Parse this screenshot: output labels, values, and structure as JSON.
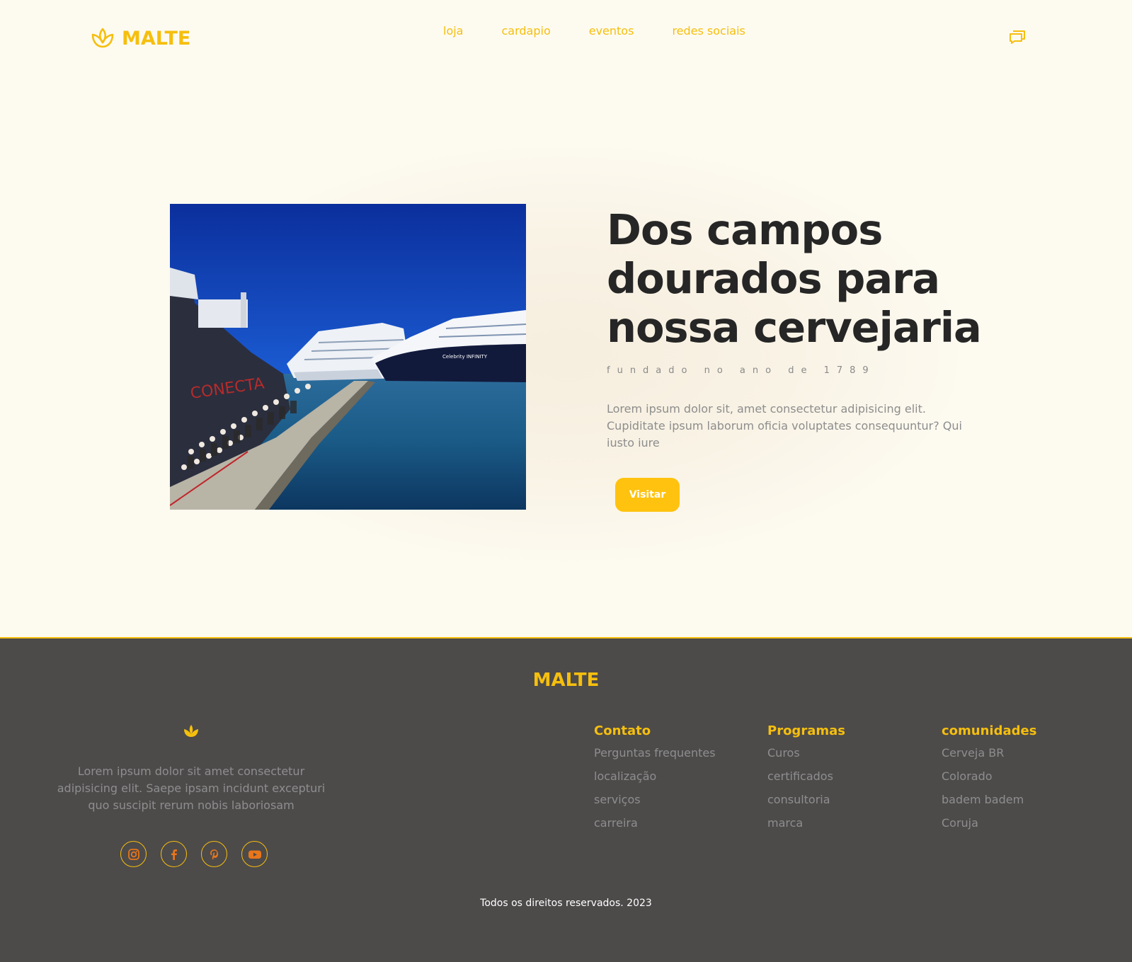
{
  "colors": {
    "accent": "#f5bf0e",
    "button": "#ffc20f",
    "footer_bg": "#4d4a4a",
    "page_bg": "#fdfaf0",
    "heading": "#262626",
    "muted_text": "#8d8d8d"
  },
  "header": {
    "brand": "MALTE",
    "logo_icon": "lotus-icon",
    "nav": [
      {
        "label": "loja"
      },
      {
        "label": "cardapio"
      },
      {
        "label": "eventos"
      },
      {
        "label": "redes sociais"
      }
    ],
    "chat_icon": "chat-bubbles-icon"
  },
  "hero": {
    "image_alt": "cruise-ships-at-pier-photo",
    "title": "Dos campos dourados para nossa cervejaria",
    "subtitle": "fundado no ano de 1789",
    "description": "Lorem ipsum dolor sit, amet consectetur adipisicing elit. Cupiditate ipsum laborum oficia voluptates consequuntur? Qui iusto iure",
    "button_label": "Visitar"
  },
  "footer": {
    "brand": "MALTE",
    "logo_icon": "lotus-icon",
    "about": "Lorem ipsum dolor sit amet consectetur adipisicing elit. Saepe ipsam incidunt excepturi quo suscipit rerum nobis laboriosam",
    "socials": [
      {
        "icon": "instagram-icon"
      },
      {
        "icon": "facebook-icon"
      },
      {
        "icon": "pinterest-icon"
      },
      {
        "icon": "youtube-icon"
      }
    ],
    "columns": [
      {
        "title": "Contato",
        "links": [
          "Perguntas frequentes",
          "localização",
          "serviços",
          "carreira"
        ]
      },
      {
        "title": "Programas",
        "links": [
          "Curos",
          "certificados",
          "consultoria",
          "marca"
        ]
      },
      {
        "title": "comunidades",
        "links": [
          "Cerveja BR",
          "Colorado",
          "badem badem",
          "Coruja"
        ]
      }
    ],
    "copyright": "Todos os direitos reservados. 2023"
  }
}
